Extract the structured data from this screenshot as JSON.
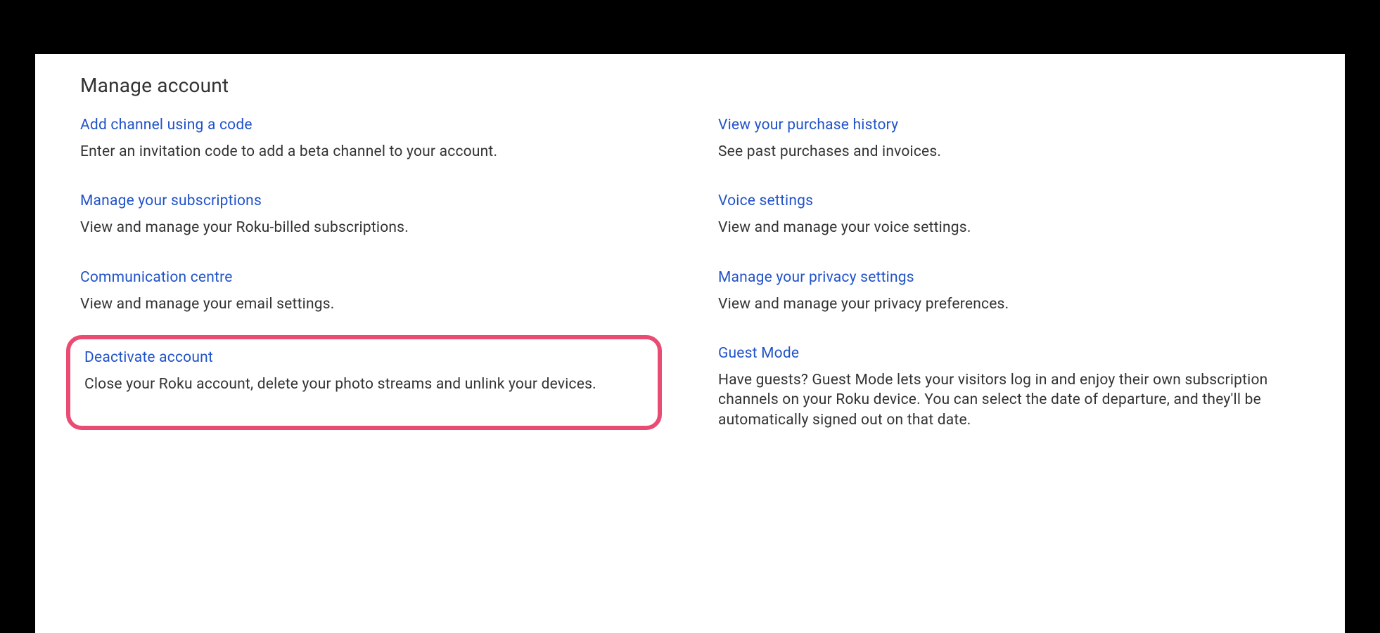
{
  "title": "Manage account",
  "highlight_color": "#e94b73",
  "link_color": "#2153c9",
  "items": {
    "add_channel": {
      "label": "Add channel using a code",
      "desc": "Enter an invitation code to add a beta channel to your account."
    },
    "purchase_history": {
      "label": "View your purchase history",
      "desc": "See past purchases and invoices."
    },
    "subscriptions": {
      "label": "Manage your subscriptions",
      "desc": "View and manage your Roku-billed subscriptions."
    },
    "voice_settings": {
      "label": "Voice settings",
      "desc": "View and manage your voice settings."
    },
    "communication": {
      "label": "Communication centre",
      "desc": "View and manage your email settings."
    },
    "privacy": {
      "label": "Manage your privacy settings",
      "desc": "View and manage your privacy preferences."
    },
    "deactivate": {
      "label": "Deactivate account",
      "desc": "Close your Roku account, delete your photo streams and unlink your devices."
    },
    "guest_mode": {
      "label": "Guest Mode",
      "desc": "Have guests? Guest Mode lets your visitors log in and enjoy their own subscription channels on your Roku device. You can select the date of departure, and they'll be automatically signed out on that date."
    }
  }
}
